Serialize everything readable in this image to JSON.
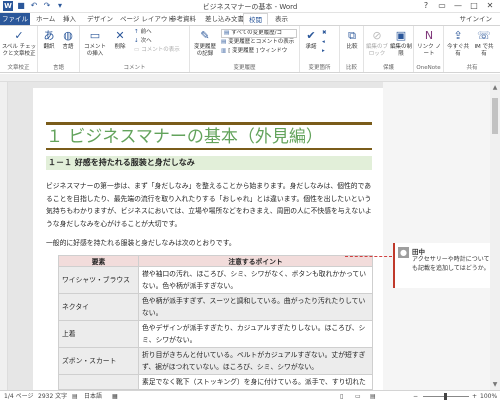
{
  "title": "ビジネスマナーの基本 - Word",
  "window": {
    "help": "?",
    "ribbon_opt": "▭",
    "minimize": "—",
    "maximize": "□",
    "close": "✕"
  },
  "tabs": [
    "ファイル",
    "ホーム",
    "挿入",
    "デザイン",
    "ページ レイアウト",
    "参考資料",
    "差し込み文書",
    "校閲",
    "表示"
  ],
  "active_tab": "校閲",
  "signin": "サインイン",
  "ribbon": {
    "groups": {
      "proofing": "文章校正",
      "language": "言語",
      "comments": "コメント",
      "tracking": "変更履歴",
      "changes": "変更箇所",
      "compare": "比較",
      "protect": "保護",
      "onenote": "OneNote",
      "share": "共有"
    },
    "spell": "スペル チェックと文章校正",
    "translate": "翻訳",
    "language": "言語",
    "new_comment": "コメントの挿入",
    "delete": "削除",
    "prev": "前へ",
    "next": "次へ",
    "show_comments": "コメントの表示",
    "track_changes": "変更履歴の記録",
    "markup_select": "すべての変更履歴/コ",
    "show_markup": "変更履歴とコメントの表示",
    "review_pane": "[ 変更履歴 ] ウィンドウ",
    "accept": "承諾",
    "compare_btn": "比較",
    "block_authors": "編集のブロック",
    "restrict": "編集の制限",
    "linked_notes": "リンク ノート",
    "share_now": "今すぐ共有",
    "im_meeting": "IM で共有"
  },
  "document": {
    "heading": "１ ビジネスマナーの基本（外見編）",
    "subheading": "１－１ 好感を持たれる服装と身だしなみ",
    "paragraph": "ビジネスマナーの第一歩は、まず「身だしなみ」を整えることから始まります。身だしなみは、個性的であることを目指したり、最先端の流行を取り入れたりする「おしゃれ」とは違います。個性を出したいという気持ちもわかりますが、ビジネスにおいては、立場や場所などをわきまえ、周囲の人に不快感を与えないような身だしなみを心がけることが大切です。",
    "paragraph2": "一般的に好感を持たれる服装と身だしなみは次のとおりです。",
    "table": {
      "headers": [
        "要素",
        "注意するポイント"
      ],
      "rows": [
        [
          "ワイシャツ・ブラウス",
          "襟や袖口の汚れ、ほころび、シミ、シワがなく、ボタンも取れかかっていない。色や柄が派手すぎない。"
        ],
        [
          "ネクタイ",
          "色や柄が派手すぎず、スーツと調和している。曲がったり汚れたりしていない。"
        ],
        [
          "上着",
          "色やデザインが派手すぎたり、カジュアルすぎたりしない。ほころび、シミ、シワがない。"
        ],
        [
          "ズボン・スカート",
          "折り目がきちんと付いている。ベルトがカジュアルすぎない。丈が短すぎず、裾がほつれていない。ほころび、シミ、シワがない。"
        ],
        [
          "",
          "素足でなく靴下（ストッキング）を身に付けている。派手で、すり切れた"
        ]
      ]
    }
  },
  "comment": {
    "author": "田中",
    "text": "アクセサリーや時計についても記載を追加してはどうか。"
  },
  "status": {
    "page": "1/4 ページ",
    "words": "2932 文字",
    "language": "日本語",
    "zoom": "100%"
  }
}
